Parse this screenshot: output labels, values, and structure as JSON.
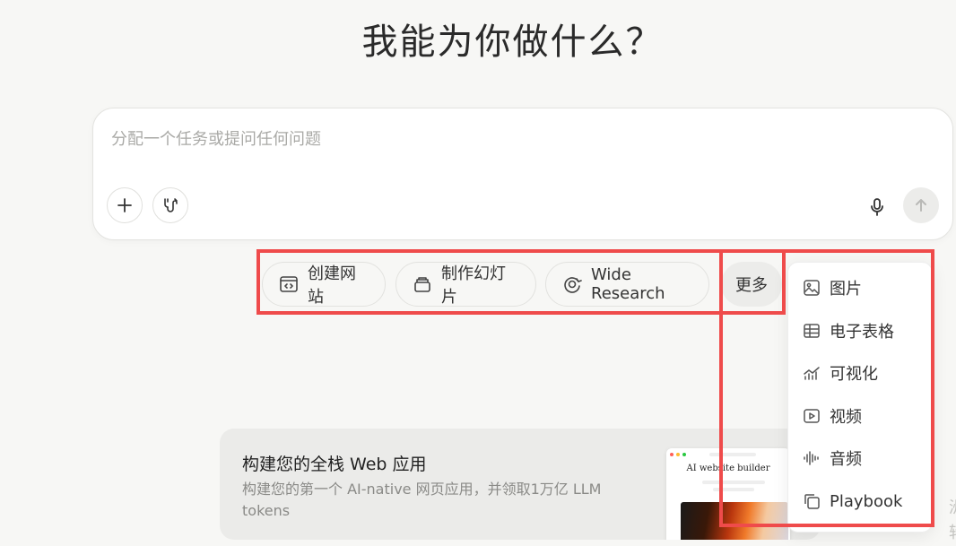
{
  "page": {
    "title": "我能为你做什么？"
  },
  "composer": {
    "placeholder": "分配一个任务或提问任何问题",
    "add_icon": "plus-icon",
    "tools_icon": "tools-icon",
    "mic_icon": "microphone-icon",
    "send_icon": "arrow-up-icon"
  },
  "quick_actions": [
    {
      "label": "创建网站",
      "icon": "code-window-icon"
    },
    {
      "label": "制作幻灯片",
      "icon": "slides-icon"
    },
    {
      "label": "Wide Research",
      "icon": "research-icon"
    }
  ],
  "more": {
    "label": "更多"
  },
  "more_menu": [
    {
      "label": "图片",
      "icon": "image-icon"
    },
    {
      "label": "电子表格",
      "icon": "table-icon"
    },
    {
      "label": "可视化",
      "icon": "chart-icon"
    },
    {
      "label": "视频",
      "icon": "video-icon"
    },
    {
      "label": "音频",
      "icon": "audio-wave-icon"
    },
    {
      "label": "Playbook",
      "icon": "copy-icon"
    }
  ],
  "promo_card": {
    "title": "构建您的全栈 Web 应用",
    "description": "构建您的第一个 AI-native 网页应用，并领取1万亿 LLM tokens",
    "preview_title": "AI website builder"
  },
  "edge": {
    "line1": "洲",
    "line2": "转"
  },
  "colors": {
    "highlight": "#ef4b4b",
    "background": "#f7f7f5"
  }
}
